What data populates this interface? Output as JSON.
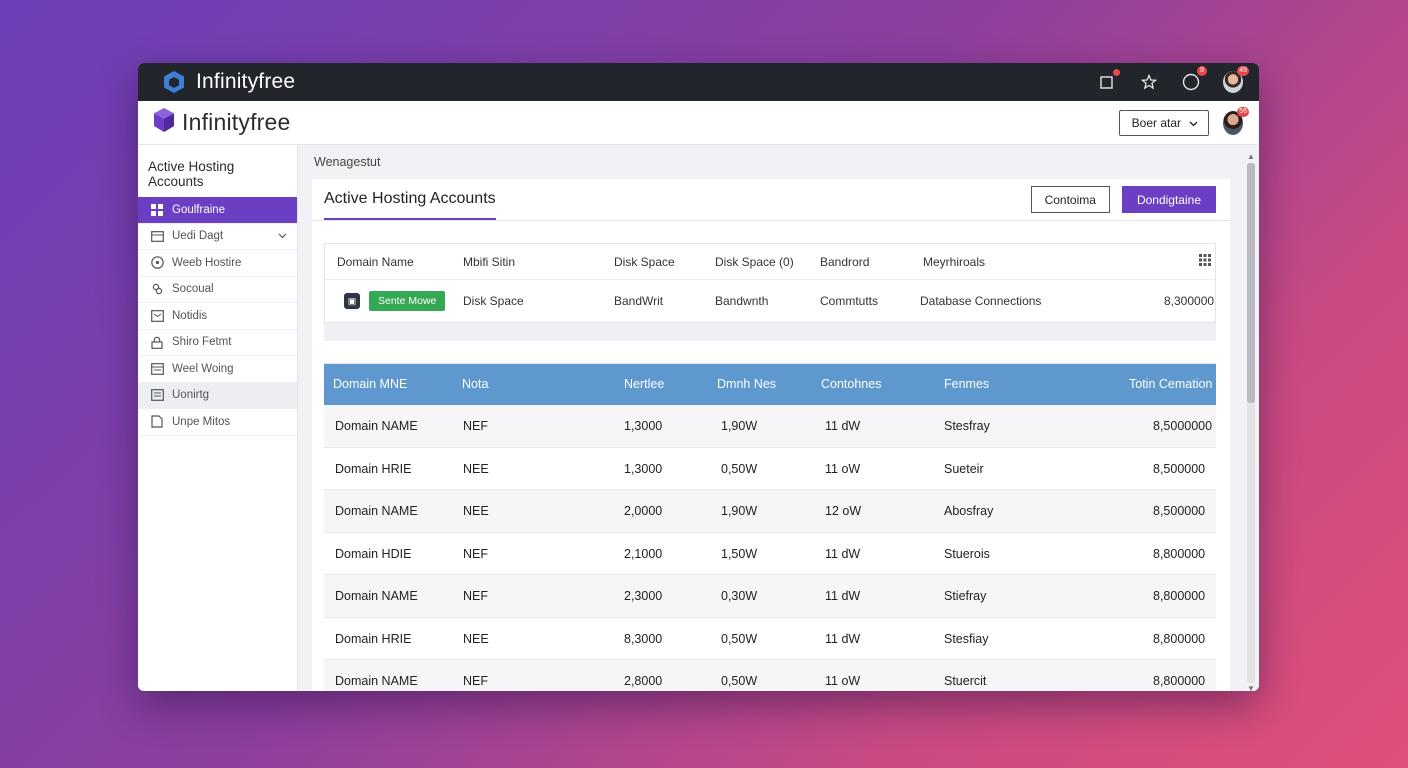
{
  "titlebar": {
    "title": "Infinityfree",
    "badges": {
      "notifications": "",
      "alerts": "9",
      "avatar": "49"
    }
  },
  "appbar": {
    "brand": "Infinityfree",
    "dropdown_label": "Boer atar",
    "avatar_badge": "56"
  },
  "sidebar": {
    "title": "Active Hosting Accounts",
    "items": [
      {
        "label": "Goulfraine",
        "icon": "grid-icon"
      },
      {
        "label": "Uedi Dagt",
        "icon": "card-icon"
      },
      {
        "label": "Weeb Hostire",
        "icon": "help-circle-icon"
      },
      {
        "label": "Socoual",
        "icon": "people-icon"
      },
      {
        "label": "Notidis",
        "icon": "inbox-icon"
      },
      {
        "label": "Shiro Fetmt",
        "icon": "lock-icon"
      },
      {
        "label": "Weel Woing",
        "icon": "calendar-icon"
      },
      {
        "label": "Uonirtg",
        "icon": "doc-icon"
      },
      {
        "label": "Unpe Mitos",
        "icon": "document-icon"
      }
    ]
  },
  "main": {
    "breadcrumb": "Wenagestut",
    "card_title": "Active Hosting Accounts",
    "btn_outline": "Contoima",
    "btn_primary": "Dondigtaine",
    "summary": {
      "headers": [
        "Domain Name",
        "Mbifi Sitin",
        "Disk Space",
        "Disk Space (0)",
        "Bandrord",
        "Meyrhiroals"
      ],
      "row": {
        "status": "Sente Mowe",
        "c1": "Disk Space",
        "c2": "BandWrit",
        "c3": "Bandwnth",
        "c4": "Commtutts",
        "c5": "Database Connections",
        "c6": "8,300000"
      }
    },
    "table": {
      "headers": [
        "Domain MNE",
        "Nota",
        "Nertlee",
        "Dmnh Nes",
        "Contohnes",
        "Fenmes",
        "Totin Cemation"
      ],
      "rows": [
        [
          "Domain NAME",
          "NEF",
          "1,3000",
          "1,90W",
          "11 dW",
          "Stesfray",
          "8,5000000"
        ],
        [
          "Domain HRIE",
          "NEE",
          "1,3000",
          "0,50W",
          "11 oW",
          "Sueteir",
          "8,500000"
        ],
        [
          "Domain NAME",
          "NEE",
          "2,0000",
          "1,90W",
          "12 oW",
          "Abosfray",
          "8,500000"
        ],
        [
          "Domain HDIE",
          "NEF",
          "2,1000",
          "1,50W",
          "11 dW",
          "Stuerois",
          "8,800000"
        ],
        [
          "Domain NAME",
          "NEF",
          "2,3000",
          "0,30W",
          "11 dW",
          "Stiefray",
          "8,800000"
        ],
        [
          "Domain HRIE",
          "NEE",
          "8,3000",
          "0,50W",
          "11 dW",
          "Stesfiay",
          "8,800000"
        ],
        [
          "Domain NAME",
          "NEF",
          "2,8000",
          "0,50W",
          "11 oW",
          "Stuercit",
          "8,800000"
        ]
      ]
    }
  }
}
